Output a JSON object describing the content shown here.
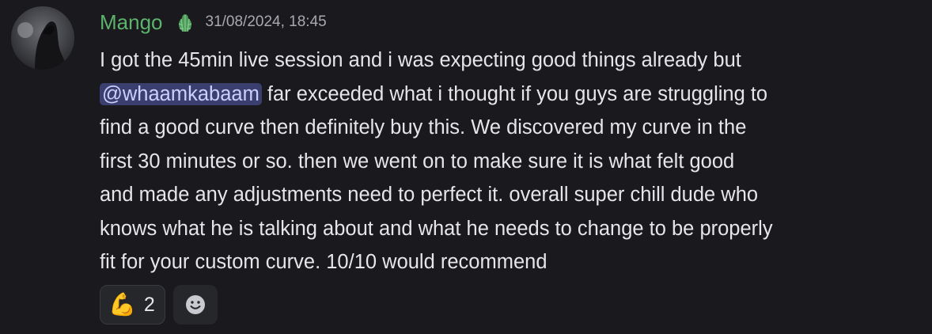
{
  "message": {
    "author": "Mango",
    "role_icon": "cactus-icon",
    "timestamp": "31/08/2024, 18:45",
    "lines": [
      {
        "text": "I got the 45min live session and i was expecting good things already but"
      },
      {
        "mention": "@whaamkabaam",
        "text": " far exceeded what i thought if you guys are struggling to"
      },
      {
        "text": "find a good curve then definitely buy this. We discovered my curve in the"
      },
      {
        "text": "first 30 minutes or so. then we went on to make sure it is what felt good"
      },
      {
        "text": "and made any adjustments need to perfect it. overall super chill dude who"
      },
      {
        "text": "knows what he is talking about and what he needs to change to be properly"
      },
      {
        "text": "fit for your custom curve. 10/10 would recommend"
      }
    ]
  },
  "reactions": [
    {
      "emoji": "💪",
      "icon": "flexed-biceps-icon",
      "count": "2"
    }
  ],
  "add_reaction_icon": "smiley-face-icon",
  "colors": {
    "background": "#1a1a1e",
    "username": "#5cb36c",
    "timestamp": "#a8a9af",
    "text": "#e6e6e8",
    "mention_bg": "#3b3f70",
    "mention_text": "#c9d0ff",
    "reaction_bg": "#26272b"
  }
}
